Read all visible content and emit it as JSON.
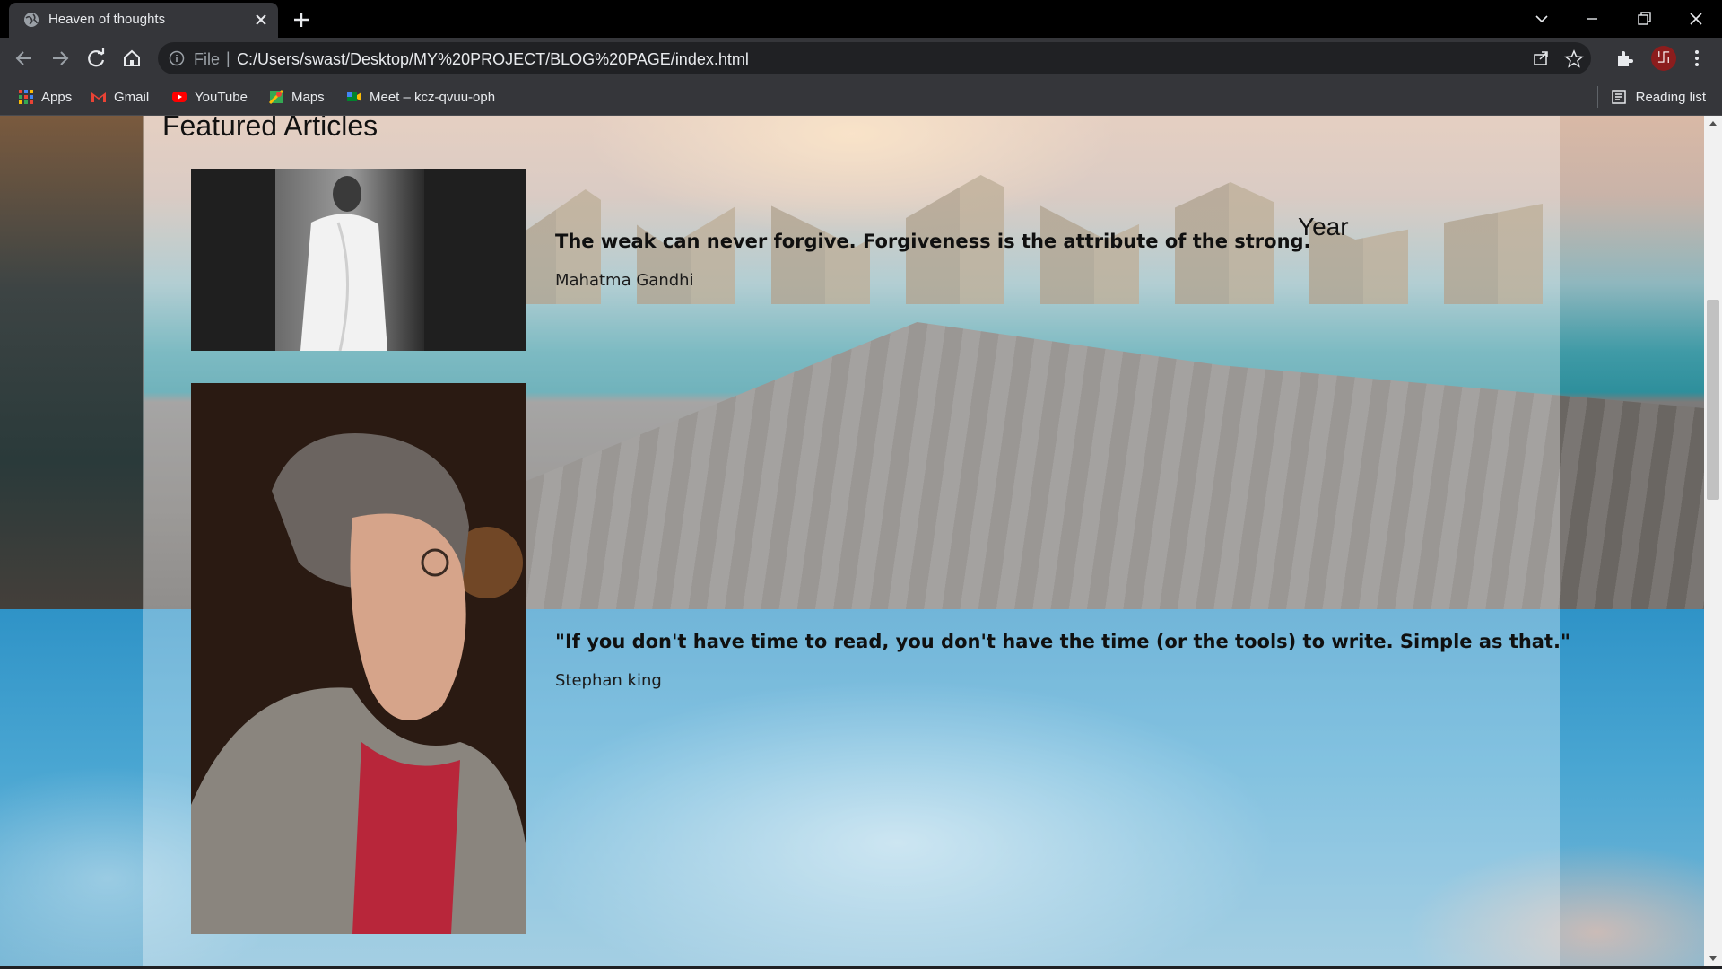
{
  "browser": {
    "tab_title": "Heaven of thoughts",
    "url_scheme": "File",
    "url": "C:/Users/swast/Desktop/MY%20PROJECT/BLOG%20PAGE/index.html",
    "profile_glyph": "卐",
    "bookmarks": [
      {
        "label": "Apps",
        "icon": "apps-grid-icon"
      },
      {
        "label": "Gmail",
        "icon": "gmail-icon"
      },
      {
        "label": "YouTube",
        "icon": "youtube-icon"
      },
      {
        "label": "Maps",
        "icon": "maps-icon"
      },
      {
        "label": "Meet – kcz-qvuu-oph",
        "icon": "meet-icon"
      }
    ],
    "reading_list": "Reading list"
  },
  "page": {
    "featured_title": "Featured Articles",
    "year_label": "Year",
    "articles": [
      {
        "quote": "The weak can never forgive. Forgiveness is the attribute of the strong.",
        "author": "Mahatma Gandhi",
        "image": "gandhi-photo"
      },
      {
        "quote": "\"If you don't have time to read, you don't have the time (or the tools) to write. Simple as that.\"",
        "author": "Stephan king",
        "image": "stephen-king-photo"
      }
    ]
  },
  "colors": {
    "tabbar": "#000000",
    "toolbar": "#35363a",
    "omnibox": "#202124",
    "panel_overlay": "rgba(255,255,255,0.32)",
    "sky": "#2f93c7"
  }
}
